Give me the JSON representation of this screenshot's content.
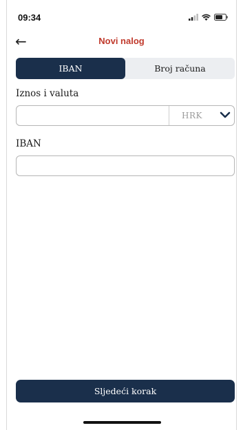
{
  "status_bar": {
    "time": "09:34"
  },
  "header": {
    "back_icon": "arrow-left-icon",
    "title": "Novi nalog"
  },
  "tabs": [
    {
      "label": "IBAN",
      "active": true
    },
    {
      "label": "Broj računa",
      "active": false
    }
  ],
  "amount": {
    "label": "Iznos i valuta",
    "value": "",
    "currency": "HRK"
  },
  "iban": {
    "label": "IBAN",
    "value": ""
  },
  "next_button": {
    "label": "Sljedeći korak"
  },
  "colors": {
    "primary": "#1a2f4b",
    "title": "#c0392b",
    "segment_bg": "#eceef1"
  }
}
